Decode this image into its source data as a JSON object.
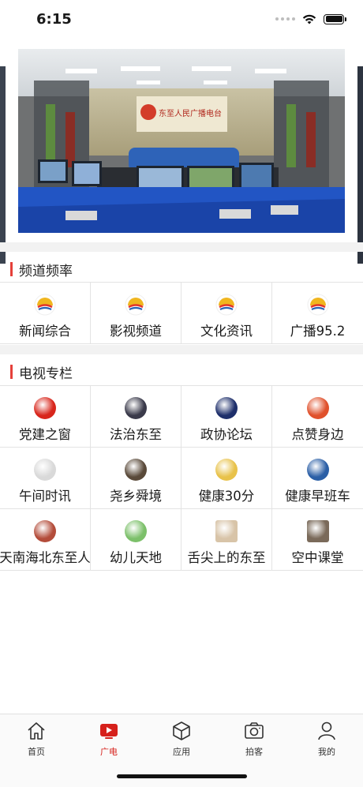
{
  "status_bar": {
    "time": "6:15"
  },
  "sections": [
    {
      "title": "频道频率",
      "items": [
        {
          "label": "新闻综合",
          "icon": "sunset-logo-icon"
        },
        {
          "label": "影视频道",
          "icon": "sunset-logo-icon"
        },
        {
          "label": "文化资讯",
          "icon": "sunset-logo-icon"
        },
        {
          "label": "广播95.2",
          "icon": "sunset-logo-icon"
        }
      ]
    },
    {
      "title": "电视专栏",
      "items": [
        {
          "label": "党建之窗",
          "icon": "party-building-icon",
          "color": "#d8261c"
        },
        {
          "label": "法治东至",
          "icon": "rule-of-law-icon",
          "color": "#3a3a4a"
        },
        {
          "label": "政协论坛",
          "icon": "cppcc-forum-icon",
          "color": "#1e2f6b"
        },
        {
          "label": "点赞身边",
          "icon": "thumbs-up-icon",
          "color": "#e0512c"
        },
        {
          "label": "午间时讯",
          "icon": "noon-news-icon",
          "color": "#d9d9d9"
        },
        {
          "label": "尧乡舜境",
          "icon": "yaoxiang-icon",
          "color": "#5a4a3a"
        },
        {
          "label": "健康30分",
          "icon": "health-30-icon",
          "color": "#e8c24a"
        },
        {
          "label": "健康早班车",
          "icon": "health-bus-icon",
          "color": "#2b5fa6"
        },
        {
          "label": "天南海北东至人",
          "icon": "dongzhi-people-icon",
          "color": "#b34c3a"
        },
        {
          "label": "幼儿天地",
          "icon": "kids-world-icon",
          "color": "#7cc06a"
        },
        {
          "label": "舌尖上的东至",
          "icon": "food-icon",
          "color": "#d8c4a8"
        },
        {
          "label": "空中课堂",
          "icon": "online-class-icon",
          "color": "#7a6a5a"
        }
      ]
    }
  ],
  "banner": {
    "studio_sign": "东至人民广播电台"
  },
  "tabbar": {
    "items": [
      {
        "label": "首页",
        "icon": "home-icon"
      },
      {
        "label": "广电",
        "icon": "tv-play-icon"
      },
      {
        "label": "应用",
        "icon": "cube-icon"
      },
      {
        "label": "拍客",
        "icon": "camera-icon"
      },
      {
        "label": "我的",
        "icon": "user-icon"
      }
    ],
    "active_color": "#d6201b"
  }
}
